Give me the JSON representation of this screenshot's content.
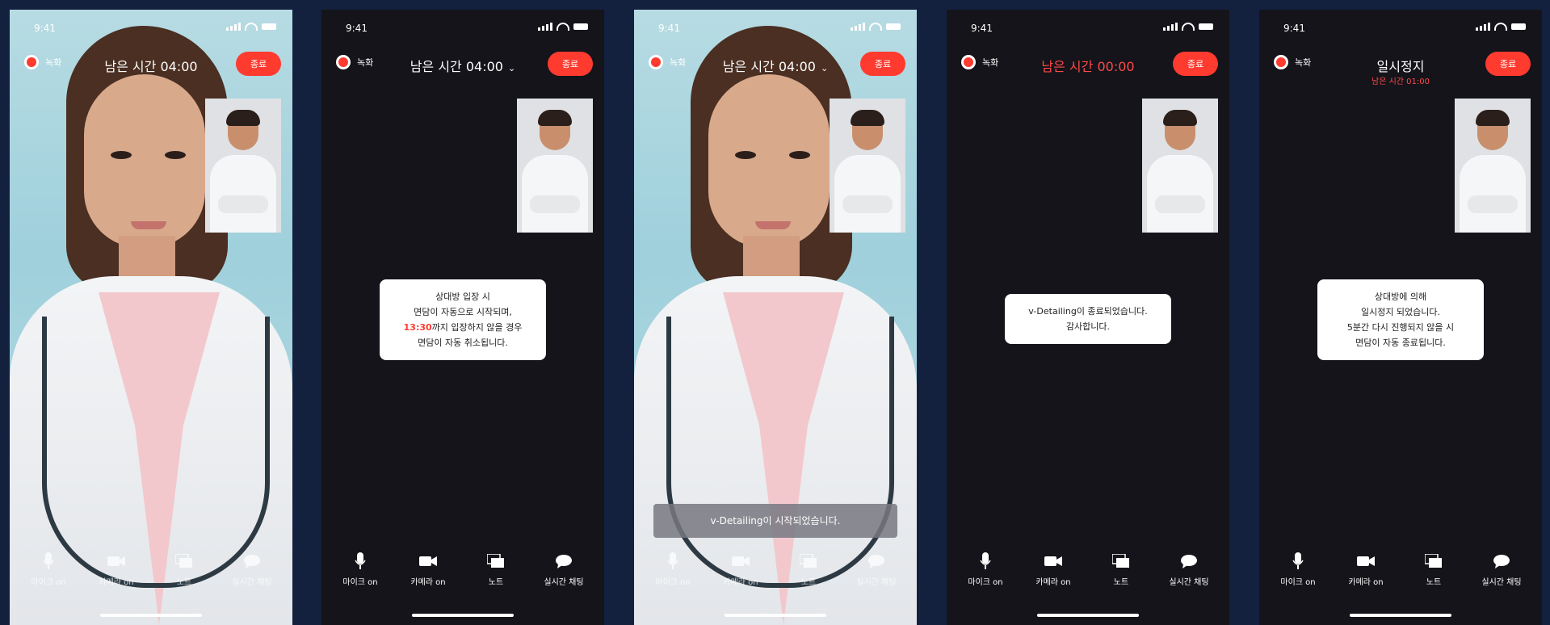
{
  "status": {
    "time": "9:41"
  },
  "labels": {
    "record": "녹화",
    "end": "종료"
  },
  "toolbar": {
    "mic": "마이크 on",
    "camera": "카메라 on",
    "note": "노트",
    "chat": "실시간 채팅"
  },
  "screens": [
    {
      "timer": "남은 시간 04:00"
    },
    {
      "timer": "남은 시간 04:00",
      "modal_line1": "상대방 입장 시",
      "modal_line2": "면담이 자동으로 시작되며,",
      "modal_time": "13:30",
      "modal_line3_rest": "까지 입장하지 않을 경우",
      "modal_line4": "면담이 자동 취소됩니다."
    },
    {
      "timer": "남은 시간 04:00",
      "toast": "v-Detailing이 시작되었습니다."
    },
    {
      "timer": "남은 시간 00:00",
      "modal_line1": "v-Detailing이 종료되었습니다.",
      "modal_line2": "감사합니다."
    },
    {
      "timer": "일시정지",
      "subtimer": "남은 시간 01:00",
      "modal_line1": "상대방에 의해",
      "modal_line2": "일시정지 되었습니다.",
      "modal_line3": "5분간 다시 진행되지 않을 시",
      "modal_line4": "면담이 자동 종료됩니다."
    }
  ],
  "colors": {
    "accent": "#ff3b30",
    "background": "#13213f",
    "dark_screen": "#14141a"
  },
  "icons": [
    "mic-icon",
    "camera-icon",
    "note-icon",
    "chat-icon",
    "record-icon",
    "chevron-down-icon"
  ]
}
